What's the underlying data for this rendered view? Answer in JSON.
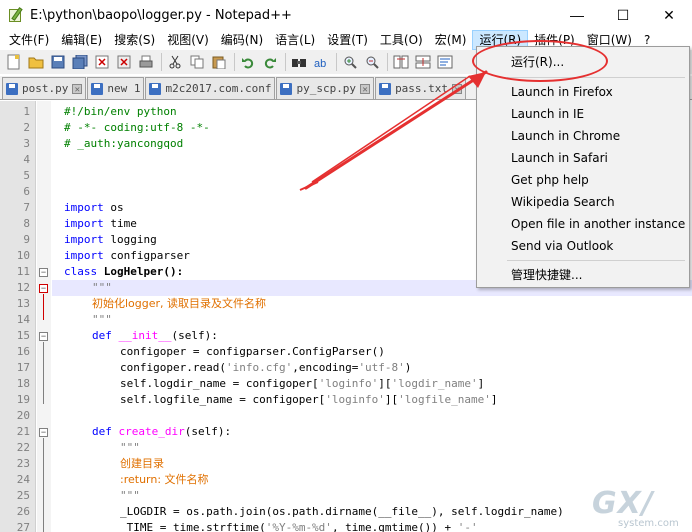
{
  "window": {
    "title": "E:\\python\\baopo\\logger.py - Notepad++",
    "minimize": "—",
    "maximize": "☐",
    "close": "✕"
  },
  "menu": [
    "文件(F)",
    "编辑(E)",
    "搜索(S)",
    "视图(V)",
    "编码(N)",
    "语言(L)",
    "设置(T)",
    "工具(O)",
    "宏(M)",
    "运行(R)",
    "插件(P)",
    "窗口(W)",
    "?"
  ],
  "active_menu": "运行(R)",
  "tabs": [
    {
      "label": "post.py"
    },
    {
      "label": "new 1"
    },
    {
      "label": "m2c2017.com.conf"
    },
    {
      "label": "py_scp.py"
    },
    {
      "label": "pass.txt"
    }
  ],
  "run_menu": {
    "items": [
      "运行(R)...",
      "Launch in Firefox",
      "Launch in IE",
      "Launch in Chrome",
      "Launch in Safari",
      "Get php help",
      "Wikipedia Search",
      "Open file in another instance",
      "Send via Outlook",
      "管理快捷键..."
    ]
  },
  "code": {
    "l1": "#!/bin/env python",
    "l2": "# -*- coding:utf-8 -*-",
    "l3": "# _auth:yancongqod",
    "l7_kw": "import",
    "l7": "os",
    "l8_kw": "import",
    "l8": "time",
    "l9_kw": "import",
    "l9": "logging",
    "l10_kw": "import",
    "l10": "configparser",
    "l11_kw": "class",
    "l11": "LogHelper():",
    "l12": "\"\"\"",
    "l13": "初始化logger, 读取目录及文件名称",
    "l14": "\"\"\"",
    "l15_kw": "def",
    "l15_fn": "__init__",
    "l15": "(self):",
    "l16": "configoper = configparser.ConfigParser()",
    "l17a": "configoper.read(",
    "l17b": "'info.cfg'",
    "l17c": ",encoding=",
    "l17d": "'utf-8'",
    "l17e": ")",
    "l18a": "self.logdir_name = configoper[",
    "l18b": "'loginfo'",
    "l18c": "][",
    "l18d": "'logdir_name'",
    "l18e": "]",
    "l19a": "self.logfile_name = configoper[",
    "l19b": "'loginfo'",
    "l19c": "][",
    "l19d": "'logfile_name'",
    "l19e": "]",
    "l21_kw": "def",
    "l21_fn": "create_dir",
    "l21": "(self):",
    "l22": "\"\"\"",
    "l23": "创建目录",
    "l24": ":return: 文件名称",
    "l25": "\"\"\"",
    "l26": "_LOGDIR = os.path.join(os.path.dirname(__file__), self.logdir_name)",
    "l27a": "_TIME = time.strftime(",
    "l27b": "'%Y-%m-%d'",
    "l27c": ", time.gmtime()) + ",
    "l27d": "'-'"
  },
  "line_numbers": [
    "1",
    "2",
    "3",
    "4",
    "5",
    "6",
    "7",
    "8",
    "9",
    "10",
    "11",
    "12",
    "13",
    "14",
    "15",
    "16",
    "17",
    "18",
    "19",
    "20",
    "21",
    "22",
    "23",
    "24",
    "25",
    "26",
    "27"
  ],
  "watermark": {
    "big": "GX/",
    "small": "system.com"
  },
  "colors": {
    "annotation": "#e53030",
    "keyword": "#0000ff",
    "comment": "#008000",
    "string": "#808080",
    "chinese_doc": "#e07000"
  }
}
